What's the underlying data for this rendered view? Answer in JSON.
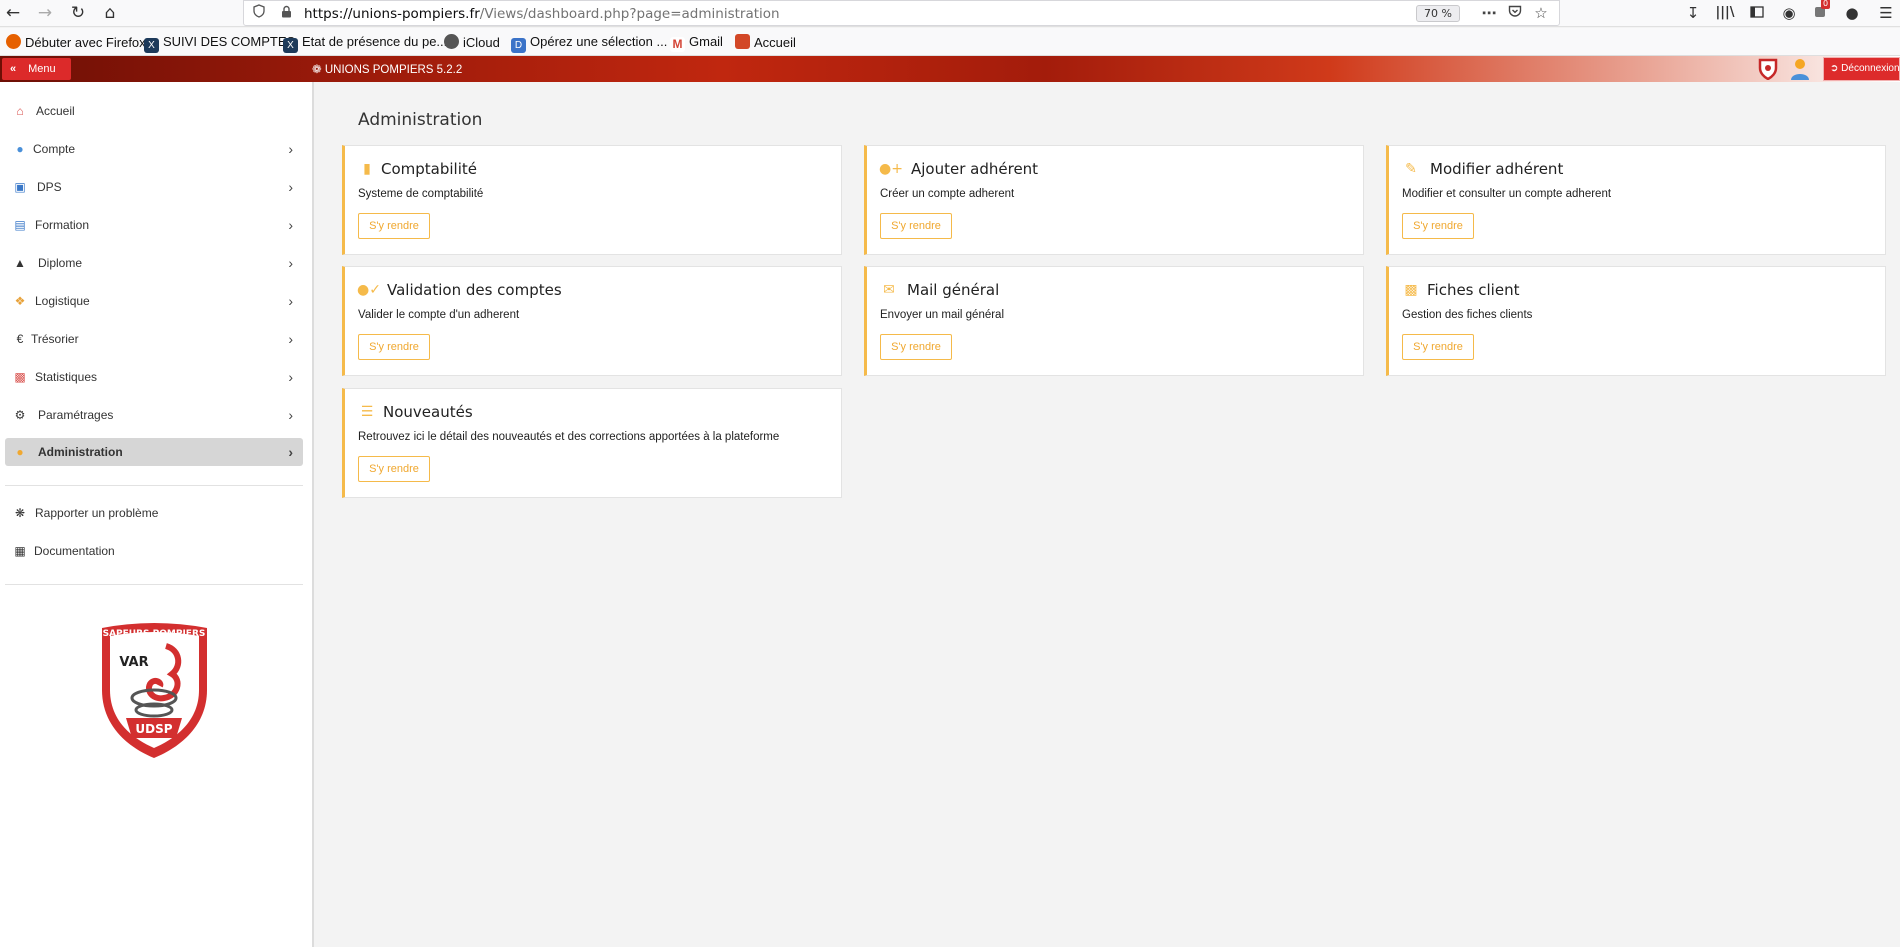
{
  "browser": {
    "url_host": "https://unions-pompiers.fr",
    "url_path": "/Views/dashboard.php?page=administration",
    "zoom": "70 %",
    "notification_count": "0"
  },
  "bookmarks": [
    {
      "label": "Débuter avec Firefox",
      "icon": "firefox-icon",
      "color": "#e66000"
    },
    {
      "label": "SUIVI DES COMPTES",
      "icon": "excel-icon",
      "color": "#1d3a5a"
    },
    {
      "label": "Etat de présence du pe...",
      "icon": "excel-icon",
      "color": "#1d3a5a"
    },
    {
      "label": "iCloud",
      "icon": "apple-icon",
      "color": "#555555"
    },
    {
      "label": "Opérez une sélection ...",
      "icon": "doc-icon",
      "color": "#3b73c8"
    },
    {
      "label": "Gmail",
      "icon": "gmail-icon",
      "color": "#d44638"
    },
    {
      "label": "Accueil",
      "icon": "home-bookmark-icon",
      "color": "#d24726"
    }
  ],
  "header": {
    "menu_label": "Menu",
    "app_title": "UNIONS POMPIERS 5.2.2",
    "logout_label": "Déconnexion"
  },
  "sidebar": {
    "items": [
      {
        "label": "Accueil",
        "icon": "home-icon",
        "color": "#d9534f",
        "has_arrow": false
      },
      {
        "label": "Compte",
        "icon": "user-icon",
        "color": "#4a90d9",
        "has_arrow": true
      },
      {
        "label": "DPS",
        "icon": "ambulance-icon",
        "color": "#3a78c8",
        "has_arrow": true
      },
      {
        "label": "Formation",
        "icon": "briefcase-icon",
        "color": "#3a78c8",
        "has_arrow": true
      },
      {
        "label": "Diplome",
        "icon": "graduation-cap-icon",
        "color": "#333333",
        "has_arrow": true
      },
      {
        "label": "Logistique",
        "icon": "cubes-icon",
        "color": "#e8a23a",
        "has_arrow": true
      },
      {
        "label": "Trésorier",
        "icon": "euro-icon",
        "color": "#333333",
        "has_arrow": true
      },
      {
        "label": "Statistiques",
        "icon": "chart-icon",
        "color": "#d9534f",
        "has_arrow": true
      },
      {
        "label": "Paramétrages",
        "icon": "cogs-icon",
        "color": "#333333",
        "has_arrow": true
      },
      {
        "label": "Administration",
        "icon": "users-cog-icon",
        "color": "#f0a830",
        "has_arrow": true,
        "active": true
      }
    ],
    "secondary": [
      {
        "label": "Rapporter un problème",
        "icon": "bug-icon"
      },
      {
        "label": "Documentation",
        "icon": "book-icon"
      }
    ],
    "logo_text": {
      "top": "SAPEURS POMPIERS",
      "middle": "VAR",
      "bottom": "UDSP"
    }
  },
  "main": {
    "title": "Administration",
    "button_label": "S'y rendre",
    "cards": [
      {
        "title": "Comptabilité",
        "description": "Systeme de comptabilité",
        "icon": "file-invoice-icon"
      },
      {
        "title": "Ajouter adhérent",
        "description": "Créer un compte adherent",
        "icon": "user-plus-icon"
      },
      {
        "title": "Modifier adhérent",
        "description": "Modifier et consulter un compte adherent",
        "icon": "edit-icon"
      },
      {
        "title": "Validation des comptes",
        "description": "Valider le compte d'un adherent",
        "icon": "user-check-icon"
      },
      {
        "title": "Mail général",
        "description": "Envoyer un mail général",
        "icon": "envelope-icon"
      },
      {
        "title": "Fiches client",
        "description": "Gestion des fiches clients",
        "icon": "address-book-icon"
      },
      {
        "title": "Nouveautés",
        "description": "Retrouvez ici le détail des nouveautés et des corrections apportées à la plateforme",
        "icon": "list-icon"
      }
    ]
  }
}
